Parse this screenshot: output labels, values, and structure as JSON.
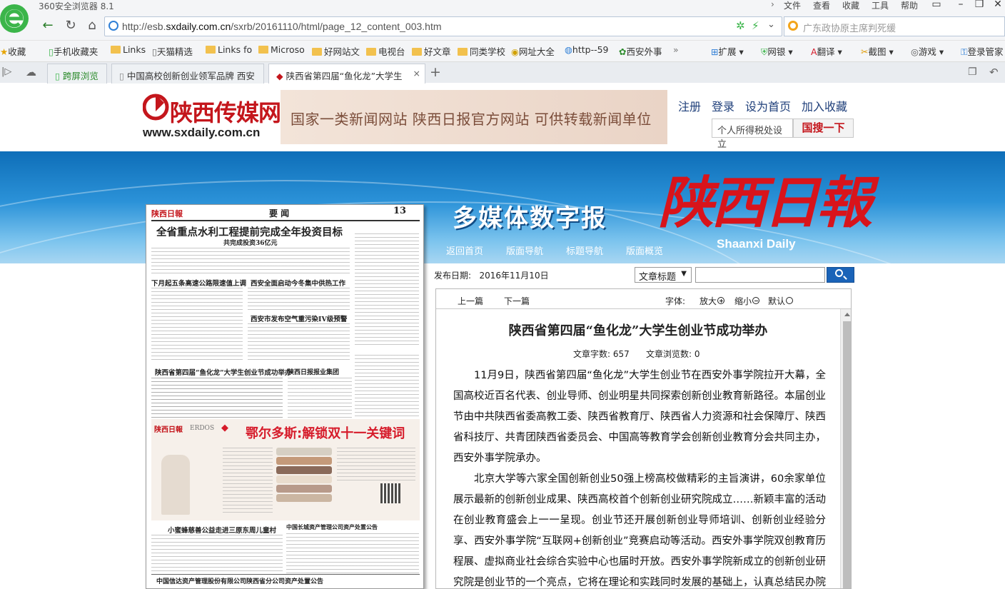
{
  "browser": {
    "title": "360安全浏览器 8.1",
    "menu": [
      "文件",
      "查看",
      "收藏",
      "工具",
      "帮助"
    ],
    "url_prefix": "http://esb.",
    "url_domain": "sxdaily.com.cn",
    "url_path": "/sxrb/20161110/html/page_12_content_003.htm",
    "search_placeholder": "广东政协原主席判死缓",
    "bookmarks": [
      "收藏",
      "手机收藏夹",
      "Links",
      "天猫精选",
      "Links fo",
      "Microso",
      "好网站文",
      "电视台",
      "好文章",
      "同类学校",
      "网址大全",
      "http--59",
      "西安外事"
    ],
    "extensions": [
      "扩展",
      "网银",
      "翻译",
      "截图",
      "游戏",
      "登录管家"
    ],
    "tabs": [
      "跨屏浏览",
      "中国高校创新创业领军品牌 西安",
      "陕西省第四届“鱼化龙”大学生"
    ]
  },
  "site": {
    "name": "陕西传媒网",
    "domain": "www.sxdaily.com.cn",
    "banner": "国家一类新闻网站   陕西日报官方网站   可供转载新闻单位",
    "links": [
      "注册",
      "登录",
      "设为首页",
      "加入收藏"
    ],
    "tax_input": "个人所得税处设立",
    "search_button": "国搜一下"
  },
  "hero": {
    "subtitle": "多媒体数字报",
    "logo": "陕西日報",
    "logo_en": "Shaanxi Daily",
    "nav": [
      "返回首页",
      "版面导航",
      "标题导航",
      "版面概览"
    ]
  },
  "paper": {
    "masthead": "陕西日報",
    "section": "要 闻",
    "page_no": "13",
    "headline": "全省重点水利工程提前完成全年投资目标",
    "subhead": "共完成投资36亿元",
    "h1": "下月起五条高速公路限速值上调",
    "h2": "西安全面启动今冬集中供热工作",
    "h3": "西安市发布空气重污染IV级预警",
    "h4": "陕西省第四届“鱼化龙”大学生创业节成功举办",
    "h5": "陕西日报报业集团",
    "h6": "中国长城资产管理公司资产处置公告",
    "h7": "小蜜蜂慈善公益走进三原东周儿童村",
    "h8": "中国信达资产管理股份有限公司陕西省分公司资产处置公告",
    "ad_brand": "鄂尔多斯",
    "ad_brand_en": "ERDOS",
    "ad_title": "鄂尔多斯:解锁双十一关键词"
  },
  "toolbar": {
    "date_label": "发布日期:",
    "date_value": "2016年11月10日",
    "select_value": "文章标题"
  },
  "article": {
    "prev": "上一篇",
    "next": "下一篇",
    "font_label": "字体:",
    "zoom_in": "放大",
    "zoom_out": "缩小",
    "default": "默认",
    "title": "陕西省第四届“鱼化龙”大学生创业节成功举办",
    "word_count": "文章字数: 657",
    "view_count": "文章浏览数: 0",
    "p1": "11月9日，陕西省第四届“鱼化龙”大学生创业节在西安外事学院拉开大幕，全国高校近百名代表、创业导师、创业明星共同探索创新创业教育新路径。本届创业节由中共陕西省委高教工委、陕西省教育厅、陕西省人力资源和社会保障厅、陕西省科技厅、共青团陕西省委员会、中国高等教育学会创新创业教育分会共同主办，西安外事学院承办。",
    "p2": "北京大学等六家全国创新创业50强上榜高校做精彩的主旨演讲，60余家单位展示最新的创新创业成果、陕西高校首个创新创业研究院成立……新颖丰富的活动在创业教育盛会上一一呈现。创业节还开展创新创业导师培训、创新创业经验分享、西安外事学院“互联网+创新创业”竞赛启动等活动。西安外事学院双创教育历程展、虚拟商业社会综合实验中心也届时开放。西安外事学院新成立的创新创业研究院是创业节的一个亮点，它将在理论和实践同时发展的基础上，认真总结民办院校创新创业教育"
  },
  "colors": {
    "brand_red": "#c4161c",
    "link_blue": "#1f3f7a",
    "hero_blue": "#1a7cc8"
  }
}
